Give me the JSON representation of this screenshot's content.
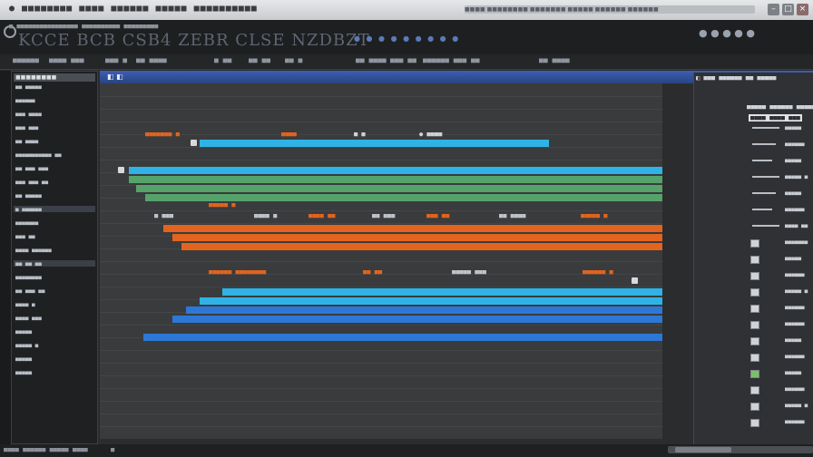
{
  "window": {
    "title": "● ■■■■■■■■ ■■■■ ■■■■■■ ■■■■■ ■■■■■■■■■■",
    "path": "■■■■ ■■■■■■■■ ■■■■■■■ ■■■■■ ■■■■■■ ■■■■■■",
    "controls": [
      "–",
      "□",
      "×"
    ]
  },
  "header": {
    "subtitle": "■ ■■■■■■■■■■■■■■■■ ■■■■■■■■■■ ■■■■■■■■■",
    "app_title": "KCCE BCB CSB4 ZEBR CLSE NZDBZT",
    "toolbar_icons": "● ● ● ● ● ● ● ● ●",
    "right_icons": "● ● ● ● ●"
  },
  "menubar": {
    "items": [
      "■■■■■■",
      "■■■■ ■■■",
      "■■■ ■",
      "■■ ■■■■",
      "■ ■■",
      "■■ ■■",
      "■■ ■",
      "■■ ■■■■",
      "■■■ ■■",
      "■■■■■■ ■■■ ■■",
      "■■ ■■■■"
    ]
  },
  "blueband": {
    "label": "◧ ◧"
  },
  "left_panel": {
    "header": "■■■■■■■■",
    "rows": [
      "■■ ■■■■■",
      "■■■■■■",
      "■■■ ■■■■",
      "■■■ ■■■",
      "■■ ■■■■",
      "■■■■■■■■■■■ ■■",
      "■■ ■■■ ■■■",
      "■■■ ■■■ ■■",
      "■■ ■■■■■",
      "■ ■■■■■■",
      "■■■■■■■",
      "■■■ ■■",
      "■■■■ ■■■■■■",
      "■■ ■■ ■■",
      "■■■■■■■■",
      "■■ ■■■ ■■",
      "■■■■ ■",
      "■■■■ ■■■",
      "■■■■■",
      "■■■■■ ■",
      "■■■■■",
      "■■■■■"
    ],
    "selected_rows": [
      9,
      13
    ],
    "footer": "■■■■ ■■■■■■ ■■■■■"
  },
  "tracks": {
    "group1_labels": [
      "■■■■■■■ ■",
      "■■■■",
      "■ ■",
      "● ■■■■"
    ],
    "group2_labels": [
      "■ ■■■",
      "■■■■■ ■",
      "■■■■ ■",
      "■■■■ ■■",
      "■■ ■■■",
      "■■■ ■■",
      "■■ ■■■■",
      "■■■■■ ■"
    ],
    "group3_labels": [
      "■■■■■■ ■■■■■■■■",
      "■■ ■■",
      "■■■■■ ■■■",
      "■■■■■■ ■"
    ],
    "colors": {
      "cyan": "#2fb3e6",
      "green": "#55a36a",
      "orange": "#e2641e",
      "blue": "#2d78d6"
    }
  },
  "right_panel": {
    "top_labels": [
      "◧ ■■■ ■■■■■■ ■■ ■■■■■",
      "■■■■■ ■■■■■■ ■■■■■",
      "■■■■ ■■■■ ■■■"
    ],
    "rows": [
      "■■■■■",
      "■■■■■■",
      "■■■■■",
      "■■■■■ ■",
      "■■■■■",
      "■■■■■■",
      "■■■■ ■■",
      "■■■■■■■",
      "■■■■■",
      "■■■■■■",
      "■■■■■ ■",
      "■■■■■■",
      "■■■■■■",
      "■■■■■",
      "■■■■■■",
      "■■■■■",
      "■■■■■■",
      "■■■■■ ■",
      "■■■■■■"
    ]
  },
  "bottom": {
    "left_label": "■■■■ ■■■■■■ ■■■■■ ■■■■",
    "mid_label": "■",
    "right_label": "■■■ ■■■■■■■"
  }
}
